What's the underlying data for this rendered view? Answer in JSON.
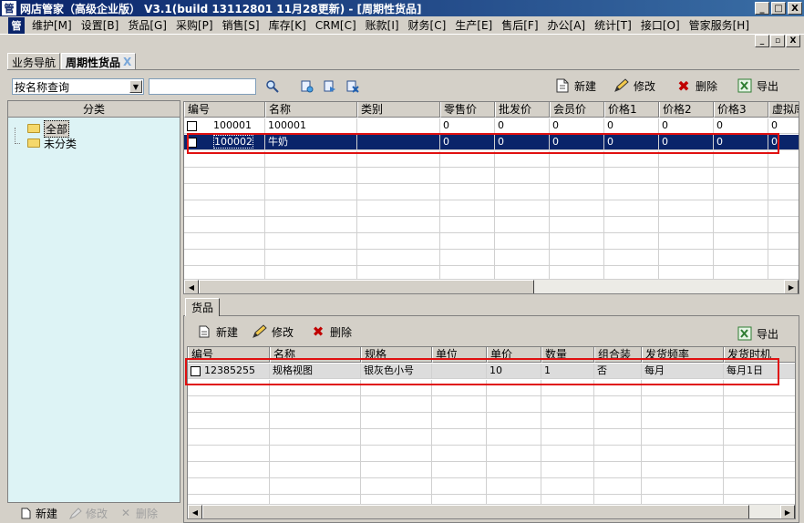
{
  "window": {
    "title": "网店管家（高级企业版） V3.1(build 13112801 11月28更新) - [周期性货品]",
    "app_icon": "管",
    "controls": [
      "_",
      "□",
      "X"
    ]
  },
  "menubar": {
    "items": [
      "维护[M]",
      "设置[B]",
      "货品[G]",
      "采购[P]",
      "销售[S]",
      "库存[K]",
      "CRM[C]",
      "账款[I]",
      "财务[C]",
      "生产[E]",
      "售后[F]",
      "办公[A]",
      "统计[T]",
      "接口[O]",
      "管家服务[H]"
    ]
  },
  "mdi_controls": [
    "_",
    "▫",
    "X"
  ],
  "tabs": [
    {
      "label": "业务导航",
      "active": false
    },
    {
      "label": "周期性货品",
      "active": true,
      "close": "X"
    }
  ],
  "search": {
    "mode": "按名称查询",
    "value": ""
  },
  "toolbar": {
    "new": "新建",
    "edit": "修改",
    "delete": "删除",
    "export": "导出"
  },
  "category": {
    "header": "分类",
    "items": [
      "全部",
      "未分类"
    ],
    "buttons": {
      "new": "新建",
      "edit": "修改",
      "delete": "删除"
    }
  },
  "upper_grid": {
    "columns": [
      "编号",
      "名称",
      "类别",
      "零售价",
      "批发价",
      "会员价",
      "价格1",
      "价格2",
      "价格3",
      "虚拟库存"
    ],
    "rows": [
      [
        "100001",
        "100001",
        "",
        "0",
        "0",
        "0",
        "0",
        "0",
        "0",
        "0"
      ],
      [
        "100002",
        "牛奶",
        "",
        "0",
        "0",
        "0",
        "0",
        "0",
        "0",
        "0"
      ]
    ]
  },
  "lower": {
    "tab": "货品",
    "toolbar": {
      "new": "新建",
      "edit": "修改",
      "delete": "删除",
      "export": "导出"
    },
    "columns": [
      "编号",
      "名称",
      "规格",
      "单位",
      "单价",
      "数量",
      "组合装",
      "发货频率",
      "发货时机"
    ],
    "rows": [
      [
        "12385255",
        "规格视图",
        "银灰色小号",
        "",
        "10",
        "1",
        "否",
        "每月",
        "每月1日"
      ]
    ]
  },
  "colors": {
    "title_bar": "#0a246a",
    "selection": "#0a246a",
    "highlight_box": "#e01010",
    "category_bg": "#ddf3f5"
  }
}
